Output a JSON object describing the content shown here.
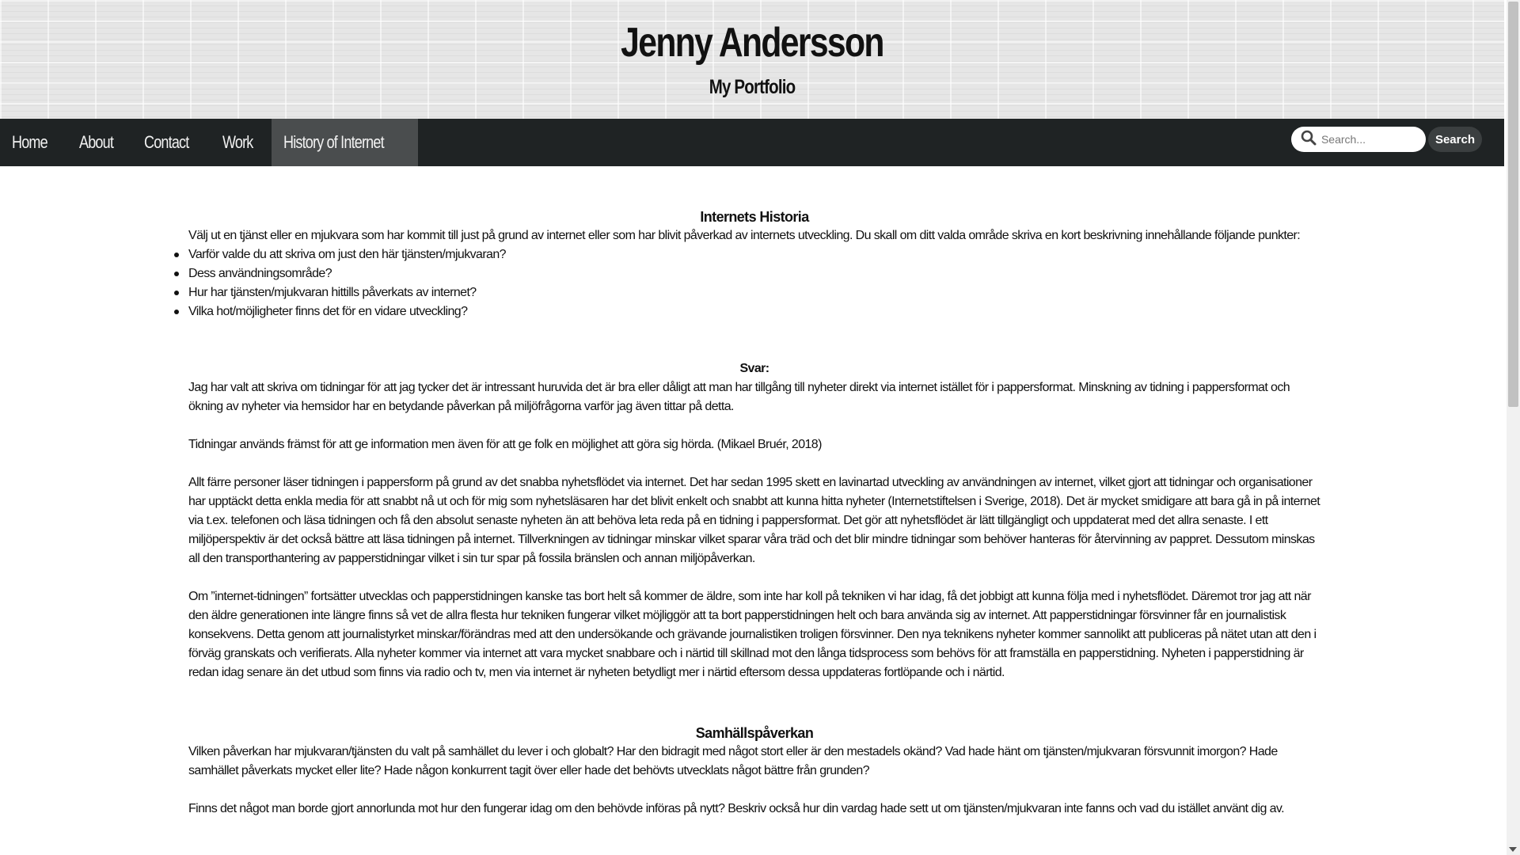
{
  "header": {
    "title": "Jenny Andersson",
    "subtitle": "My Portfolio"
  },
  "nav": {
    "items": [
      {
        "label": "Home"
      },
      {
        "label": "About"
      },
      {
        "label": "Contact"
      },
      {
        "label": "Work"
      },
      {
        "label": "History of Internet",
        "active": true
      }
    ],
    "search": {
      "placeholder": "Search...",
      "value": "",
      "button_label": "Search",
      "icon": "search-icon"
    }
  },
  "content": {
    "section1": {
      "heading": "Internets Historia",
      "intro": "Välj ut en tjänst eller en mjukvara som har kommit till just på grund av internet eller som har blivit påverkad av internets utveckling. Du skall om ditt valda område skriva en kort beskrivning innehållande följande punkter:",
      "bullets": [
        "Varför valde du att skriva om just den här tjänsten/mjukvaran?",
        "Dess användningsområde?",
        "Hur har tjänsten/mjukvaran hittills påverkats av internet?",
        "Vilka hot/möjligheter finns det för en vidare utveckling?"
      ]
    },
    "answer": {
      "heading": "Svar:",
      "paragraphs": [
        "Jag har valt att skriva om tidningar för att jag tycker det är intressant huruvida det är bra eller dåligt att man har tillgång till nyheter direkt via internet istället för i pappersformat. Minskning av tidning i pappersformat och ökning av nyheter via hemsidor har en betydande påverkan på miljöfrågorna varför jag även tittar på detta.",
        "Tidningar används främst för att ge information men även för att ge folk en möjlighet att göra sig hörda. (Mikael Bruér, 2018)",
        "Allt färre personer läser tidningen i pappersform på grund av det snabba nyhetsflödet via internet. Det har sedan 1995 skett en lavinartad utveckling av användningen av internet, vilket gjort att tidningar och organisationer har upptäckt detta enkla media för att snabbt nå ut och för mig som nyhetsläsaren har det blivit enkelt och snabbt att kunna hitta nyheter (Internetstiftelsen i Sverige, 2018). Det är mycket smidigare att bara gå in på internet via t.ex. telefonen och läsa tidningen och få den absolut senaste nyheten än att behöva leta reda på en tidning i pappersformat. Det gör att nyhetsflödet är lätt tillgängligt och uppdaterat med det allra senaste. I ett miljöperspektiv är det också bättre att läsa tidningen på internet. Tillverkningen av tidningar minskar vilket sparar våra träd och det blir mindre tidningar som behöver hanteras för återvinning av pappret. Dessutom minskas all den transporthantering av papperstidningar vilket i sin tur spar på fossila bränslen och annan miljöpåverkan.",
        "Om ”internet-tidningen” fortsätter utvecklas och papperstidningen kanske tas bort helt så kommer de äldre, som inte har koll på tekniken vi har idag, få det jobbigt att kunna följa med i nyhetsflödet. Däremot tror jag att när den äldre generationen inte längre finns så vet de allra flesta hur tekniken fungerar vilket möjliggör att ta bort papperstidningen helt och bara använda sig av internet. Att papperstidningar försvinner får en journalistisk konsekvens. Detta genom att journalistyrket minskar/förändras med att den undersökande och grävande journalistiken troligen försvinner. Den nya teknikens nyheter kommer sannolikt att publiceras på nätet utan att den i förväg granskats och verifierats. Alla nyheter kommer via internet att vara mycket snabbare och i närtid till skillnad mot den långa tidsprocess som behövs för att framställa en papperstidning. Nyheten i papperstidning är redan idag senare än det utbud som finns via radio och tv, men via internet är nyheten betydligt mer i närtid eftersom dessa uppdateras fortlöpande och i närtid."
      ]
    },
    "section2": {
      "heading": "Samhällspåverkan",
      "paragraphs": [
        "Vilken påverkan har mjukvaran/tjänsten du valt på samhället du lever i och globalt? Har den bidragit med något stort eller är den mestadels okänd? Vad hade hänt om tjänsten/mjukvaran försvunnit imorgon? Hade samhället påverkats mycket eller lite? Hade någon konkurrent tagit över eller hade det behövts utvecklats något bättre från grunden?",
        "Finns det något man borde gjort annorlunda mot hur den fungerar idag om den behövde införas på nytt? Beskriv också hur din vardag hade sett ut om tjänsten/mjukvaran inte fanns och vad du istället använt dig av."
      ]
    }
  }
}
